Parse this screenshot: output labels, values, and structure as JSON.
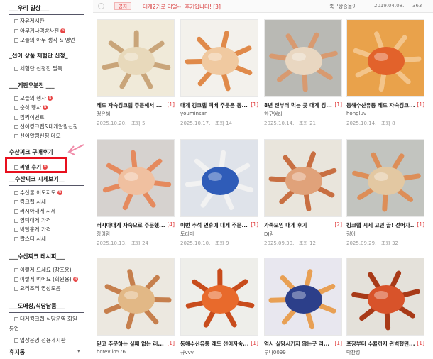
{
  "sidebar": {
    "sections": [
      {
        "title": "___우리 일상___",
        "items": [
          {
            "label": "자유게시판",
            "badge": false
          },
          {
            "label": "아무거나먹방사진",
            "badge": true
          },
          {
            "label": "오늘의 아무 생각 & 명언",
            "badge": false
          }
        ]
      },
      {
        "title": "_선어 상품 체험단 신청_",
        "items": [
          {
            "label": "체험단 신청전 필독",
            "badge": false
          }
        ]
      },
      {
        "title": "___게판오분전 ___",
        "items": [
          {
            "label": "오늘의 행사",
            "badge": true
          },
          {
            "label": "순삭 행사",
            "badge": true
          },
          {
            "label": "깜짝이벤트",
            "badge": false
          },
          {
            "label": "선어킹크랩&대게알림신청",
            "badge": false
          },
          {
            "label": "선어알림신청 메모",
            "badge": false
          }
        ]
      },
      {
        "title": "수산찌크 구매후기",
        "items": [
          {
            "label": "리얼 후기",
            "badge": true
          }
        ]
      },
      {
        "title": "__수산찌크 시세보기__",
        "items": [
          {
            "label": "수산물 이모저모",
            "badge": true
          },
          {
            "label": "킹크랩 시세",
            "badge": false
          },
          {
            "label": "러시아대게 시세",
            "badge": false
          },
          {
            "label": "영덕대게 가격",
            "badge": false
          },
          {
            "label": "박달홍게 가격",
            "badge": false
          },
          {
            "label": "랍스터 시세",
            "badge": false
          }
        ]
      },
      {
        "title": "___수산찌크 레시피___",
        "items": [
          {
            "label": "이렇게 드세요 (참조용)",
            "badge": false
          },
          {
            "label": "이렇게 먹어요 (회원용)",
            "badge": true
          },
          {
            "label": "요리조리 영상모음",
            "badge": false
          }
        ]
      },
      {
        "title": "___도매상,식당납품___",
        "items": [
          {
            "label": "대게킹크랩 식당운영 회원",
            "badge": false
          },
          {
            "label": "등업",
            "badge": false
          },
          {
            "label": "업장운영 전용게시판",
            "badge": false
          }
        ]
      },
      {
        "title": "휴지통",
        "items": []
      }
    ]
  },
  "notice": {
    "tag": "공지",
    "title": "대게2키로 리얼--! 후기입니다! [3]",
    "author": "축구왕승돌이",
    "date": "2019.04.08.",
    "views": "363"
  },
  "cards": [
    {
      "title": "레드 자숙킹크랩 주문해서 ...",
      "count": "[1]",
      "author": "정은혜",
      "meta": "2025.10.20. · 조회 5",
      "palette": [
        "#f0ead9",
        "#e8d9bb",
        "#c9a57a"
      ]
    },
    {
      "title": "대게 킹크랩 택배 주문은 동...",
      "count": "[1]",
      "author": "youminsan",
      "meta": "2025.10.17. · 조회 14",
      "palette": [
        "#f3f1ec",
        "#f0c9a0",
        "#e08a4a"
      ]
    },
    {
      "title": "8년 전부터 먹는 곳 대게 킹...",
      "count": "[1]",
      "author": "한구엄라",
      "meta": "2025.10.14. · 조회 21",
      "palette": [
        "#b9b9b4",
        "#e9d7c1",
        "#d89a70"
      ]
    },
    {
      "title": "동해수산유통 레드 자숙킹크...",
      "count": "[1]",
      "author": "hongluv",
      "meta": "2025.10.14. · 조회 8",
      "palette": [
        "#e9a24b",
        "#e2622b",
        "#f3c48a"
      ]
    },
    {
      "title": "러시아대게 자숙으로 주문했...",
      "count": "[4]",
      "author": "장이맘",
      "meta": "2025.10.13. · 조회 24",
      "palette": [
        "#d6d2cf",
        "#f0c0a0",
        "#e58a5e"
      ]
    },
    {
      "title": "이번 추석 연휴에 대게 주문...",
      "count": "[1]",
      "author": "토리미",
      "meta": "2025.10.10. · 조회 9",
      "palette": [
        "#dfe3ea",
        "#2f5cb8",
        "#f2f2f2"
      ]
    },
    {
      "title": "가족모임 대게 후기",
      "count": "[2]",
      "author": "DJ맘",
      "meta": "2025.09.30. · 조회 12",
      "palette": [
        "#e9e5dc",
        "#e0a27a",
        "#c86f42"
      ]
    },
    {
      "title": "킹크랩 시세 고민 끝! 선어자...",
      "count": "[1]",
      "author": "링이",
      "meta": "2025.09.29. · 조회 32",
      "palette": [
        "#c2c4bf",
        "#e3c8a2",
        "#dd8e58"
      ]
    },
    {
      "title": "믿고 주문하는 실패 없는 러...",
      "count": "[1]",
      "author": "hcrevllo576",
      "meta": "",
      "palette": [
        "#ece8e0",
        "#e2b886",
        "#c67f4d"
      ]
    },
    {
      "title": "동해수산유통 레드 선어자숙...",
      "count": "[1]",
      "author": "규vvv",
      "meta": "",
      "palette": [
        "#eeeeea",
        "#e86a2c",
        "#c84c1c"
      ]
    },
    {
      "title": "역시 실망시키지 않는곳 러...",
      "count": "[1]",
      "author": "루나0099",
      "meta": "",
      "palette": [
        "#e8e7ef",
        "#2c3f8a",
        "#e8a054"
      ]
    },
    {
      "title": "포장부터 수율까지 완벽했던...",
      "count": "[1]",
      "author": "박찬성",
      "meta": "",
      "palette": [
        "#e4e1da",
        "#d8532a",
        "#a83a18"
      ]
    }
  ],
  "icons": {
    "checkbox": "checkbox-icon",
    "new": "new-badge-icon",
    "arrow": "pink-arrow-icon"
  },
  "colors": {
    "highlight": "#e8101e",
    "count": "#e04040",
    "arrow": "#f08aa8"
  }
}
